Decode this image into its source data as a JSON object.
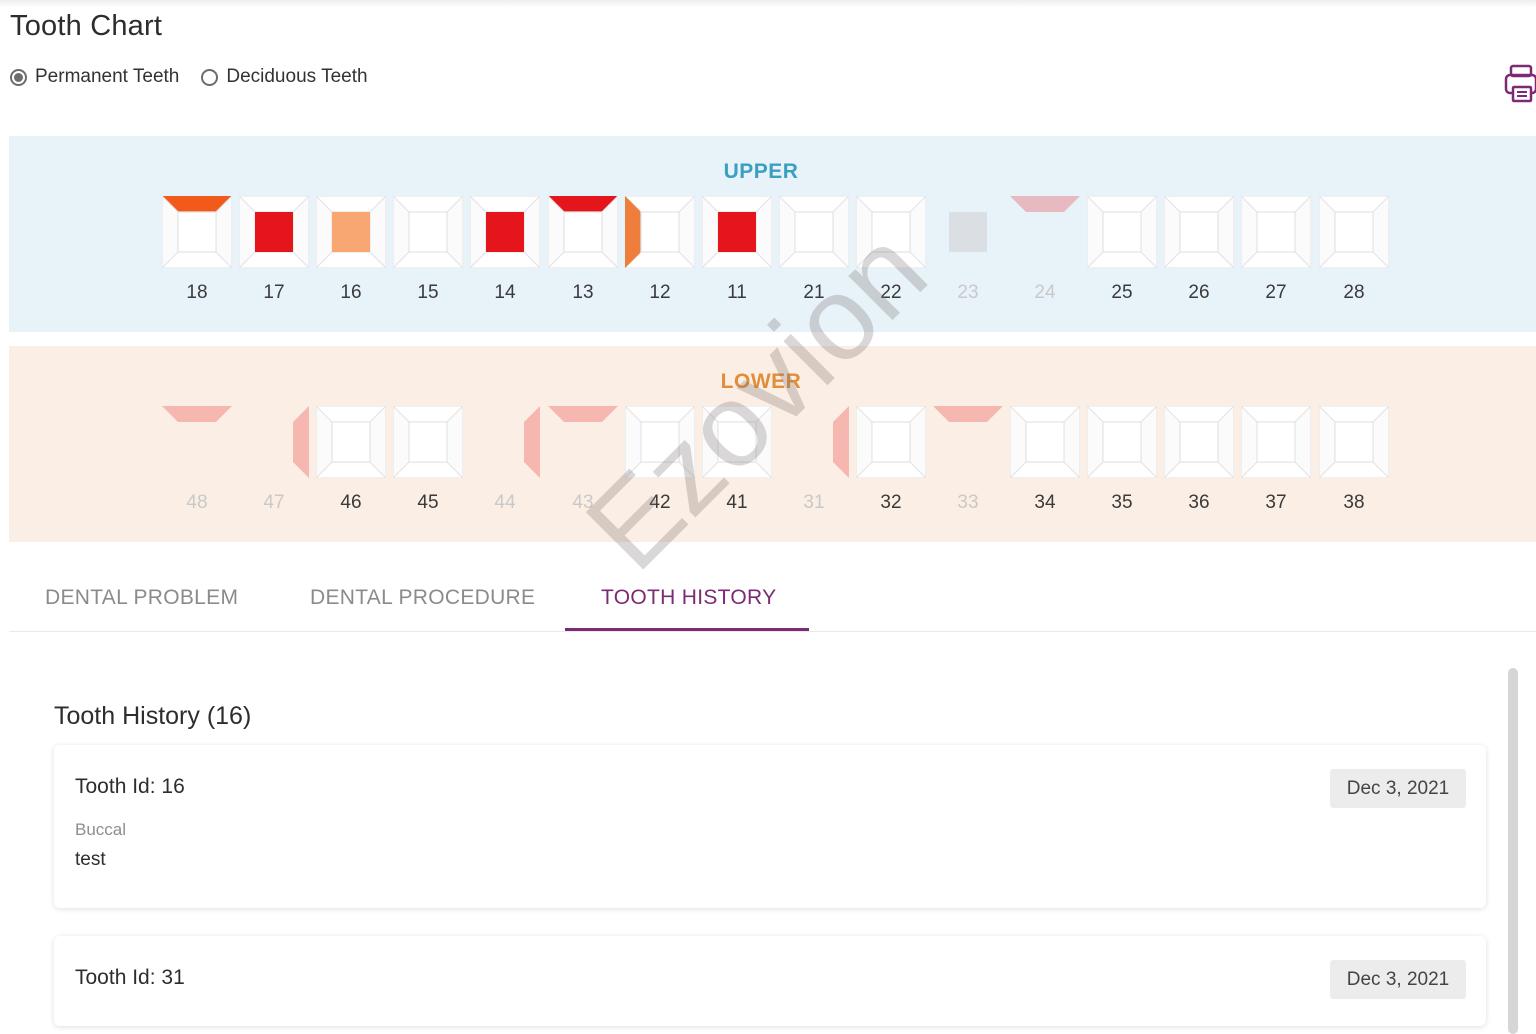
{
  "page": {
    "title": "Tooth Chart"
  },
  "dentition": {
    "options": [
      {
        "label": "Permanent Teeth",
        "selected": true
      },
      {
        "label": "Deciduous Teeth",
        "selected": false
      }
    ]
  },
  "toolbar": {
    "print_icon": "printer-icon"
  },
  "colors": {
    "upper_bg": "#e8f2f9",
    "lower_bg": "#fbeee4",
    "upper_label": "#3b9fc2",
    "lower_label": "#e08e3a",
    "accent": "#7b2a73",
    "red": "#e4161b",
    "orange_red": "#f25a1c",
    "peach": "#f8a772",
    "orange": "#ef7d3c"
  },
  "upper": {
    "label": "UPPER",
    "teeth": [
      {
        "id": "18",
        "status": "normal",
        "marks": [
          {
            "surface": "top",
            "color": "#f25a1c"
          }
        ]
      },
      {
        "id": "17",
        "status": "normal",
        "marks": [
          {
            "surface": "center",
            "color": "#e4161b"
          }
        ]
      },
      {
        "id": "16",
        "status": "normal",
        "marks": [
          {
            "surface": "center",
            "color": "#f8a772"
          }
        ]
      },
      {
        "id": "15",
        "status": "normal",
        "marks": []
      },
      {
        "id": "14",
        "status": "normal",
        "marks": [
          {
            "surface": "center",
            "color": "#e4161b"
          }
        ]
      },
      {
        "id": "13",
        "status": "normal",
        "marks": [
          {
            "surface": "top",
            "color": "#e4161b"
          }
        ]
      },
      {
        "id": "12",
        "status": "normal",
        "marks": [
          {
            "surface": "left",
            "color": "#ef7d3c"
          }
        ]
      },
      {
        "id": "11",
        "status": "normal",
        "marks": [
          {
            "surface": "center",
            "color": "#e4161b"
          }
        ]
      },
      {
        "id": "21",
        "status": "normal",
        "marks": []
      },
      {
        "id": "22",
        "status": "normal",
        "marks": []
      },
      {
        "id": "23",
        "status": "missing",
        "marks": [
          {
            "surface": "center",
            "color": "#b8a8a8"
          }
        ]
      },
      {
        "id": "24",
        "status": "missing",
        "marks": [
          {
            "surface": "top",
            "color": "#e4161b"
          }
        ]
      },
      {
        "id": "25",
        "status": "normal",
        "marks": []
      },
      {
        "id": "26",
        "status": "normal",
        "marks": []
      },
      {
        "id": "27",
        "status": "normal",
        "marks": []
      },
      {
        "id": "28",
        "status": "normal",
        "marks": []
      }
    ]
  },
  "lower": {
    "label": "LOWER",
    "teeth": [
      {
        "id": "48",
        "status": "missing",
        "marks": [
          {
            "surface": "top",
            "color": "#e4161b"
          }
        ]
      },
      {
        "id": "47",
        "status": "missing",
        "marks": [
          {
            "surface": "right",
            "color": "#e4161b"
          }
        ]
      },
      {
        "id": "46",
        "status": "normal",
        "marks": []
      },
      {
        "id": "45",
        "status": "normal",
        "marks": []
      },
      {
        "id": "44",
        "status": "missing",
        "marks": [
          {
            "surface": "right",
            "color": "#e4161b"
          }
        ]
      },
      {
        "id": "43",
        "status": "missing",
        "marks": [
          {
            "surface": "top",
            "color": "#e4161b"
          }
        ]
      },
      {
        "id": "42",
        "status": "normal",
        "marks": []
      },
      {
        "id": "41",
        "status": "normal",
        "marks": []
      },
      {
        "id": "31",
        "status": "missing",
        "marks": [
          {
            "surface": "right",
            "color": "#e4161b"
          }
        ]
      },
      {
        "id": "32",
        "status": "normal",
        "marks": []
      },
      {
        "id": "33",
        "status": "missing",
        "marks": [
          {
            "surface": "top",
            "color": "#e4161b"
          }
        ]
      },
      {
        "id": "34",
        "status": "normal",
        "marks": []
      },
      {
        "id": "35",
        "status": "normal",
        "marks": []
      },
      {
        "id": "36",
        "status": "normal",
        "marks": []
      },
      {
        "id": "37",
        "status": "normal",
        "marks": []
      },
      {
        "id": "38",
        "status": "normal",
        "marks": []
      }
    ]
  },
  "tabs": [
    {
      "label": "DENTAL PROBLEM",
      "active": false
    },
    {
      "label": "DENTAL PROCEDURE",
      "active": false
    },
    {
      "label": "TOOTH HISTORY",
      "active": true
    }
  ],
  "watermark": "Ezovion",
  "history": {
    "title": "Tooth History (16)",
    "entries": [
      {
        "tooth_id": "Tooth Id: 16",
        "date": "Dec 3, 2021",
        "surface": "Buccal",
        "note": "test"
      },
      {
        "tooth_id": "Tooth Id: 31",
        "date": "Dec 3, 2021"
      }
    ]
  }
}
